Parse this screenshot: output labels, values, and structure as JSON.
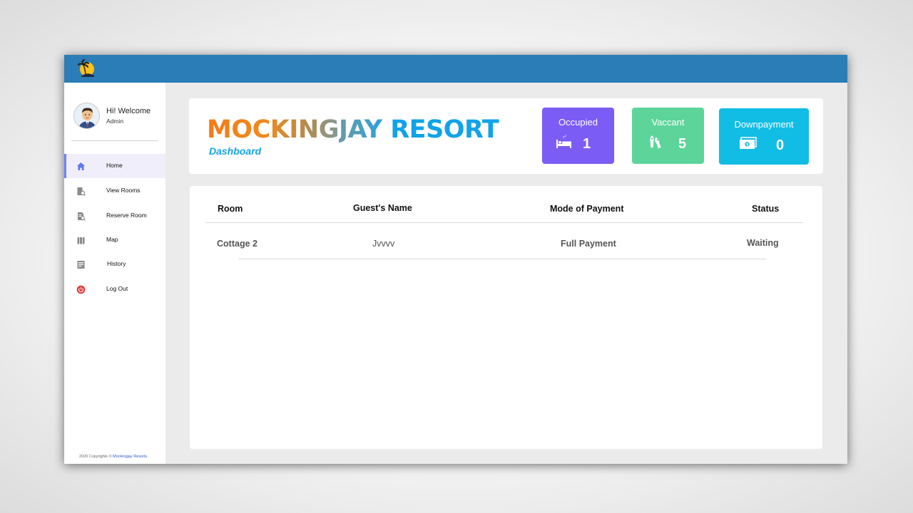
{
  "sidebar": {
    "welcome": "Hi! Welcome",
    "role": "Admin",
    "items": [
      {
        "label": "Home",
        "icon": "home-icon"
      },
      {
        "label": "View Rooms",
        "icon": "view-rooms-icon"
      },
      {
        "label": "Reserve Room",
        "icon": "reserve-room-icon"
      },
      {
        "label": "Map",
        "icon": "map-icon"
      },
      {
        "label": "History",
        "icon": "history-icon"
      },
      {
        "label": "Log Out",
        "icon": "power-icon"
      }
    ],
    "copyright": "2020 Copyrights ©",
    "copyright_brand": "Mockingjay Resorts"
  },
  "header": {
    "title_part1": "MOCKING",
    "title_part2": "JAY",
    "title_part3": " RESORT",
    "subtitle": "Dashboard"
  },
  "stats": {
    "occupied": {
      "label": "Occupied",
      "value": "1",
      "color": "#7b5cf5"
    },
    "vaccant": {
      "label": "Vaccant",
      "value": "5",
      "color": "#5dd49a"
    },
    "downpayment": {
      "label": "Downpayment",
      "value": "0",
      "color": "#11bde4"
    }
  },
  "table": {
    "headers": {
      "room": "Room",
      "guest": "Guest's Name",
      "payment": "Mode of Payment",
      "status": "Status"
    },
    "rows": [
      {
        "room": "Cottage 2",
        "guest": "Jvvvv",
        "payment": "Full Payment",
        "status": "Waiting"
      }
    ]
  },
  "colors": {
    "topbar": "#2a7db6",
    "accent": "#6f82f5"
  }
}
